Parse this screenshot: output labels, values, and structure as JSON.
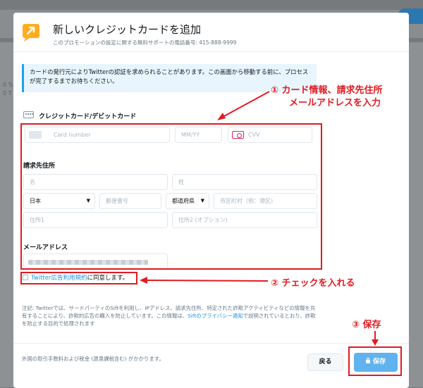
{
  "background": {
    "left_text": "0 Tu",
    "left_text2": "0 T"
  },
  "modal": {
    "title": "新しいクレジットカードを追加",
    "subtitle": "このプロモーションの設定に関する無料サポートの電話番号: 415-888-9999",
    "notice": "カードの発行元によりTwitterの認証を求められることがあります。この画面から移動する前に、プロセスが完了するまでお待ちください。",
    "card_section_label": "クレジットカード/デビットカード",
    "card_number_placeholder": "Card number",
    "expiry_placeholder": "MM/YY",
    "cvv_placeholder": "CVV",
    "billing_label": "請求先住所",
    "first_name_placeholder": "名",
    "last_name_placeholder": "姓",
    "country_value": "日本",
    "postal_placeholder": "郵便番号",
    "prefecture_value": "都道府県",
    "city_placeholder": "市区町村（例：港区)",
    "address1_placeholder": "住所1",
    "address2_placeholder": "住所2 (オプション)",
    "email_label": "メールアドレス",
    "agree_link": "Twitter広告利用規約",
    "agree_text": "に同意します。",
    "note_part1": "注記: Twitterでは、サードパーティのSiftを利用し、IPアドレス、請求先住所、特定された詐欺アクティビティなどの情報を共有することにより、詐欺的広告の購入を防止しています。この情報は、",
    "note_link": "Siftのプライバシー通知",
    "note_part2": "で説明されているとおり、詐欺を防止する目的で処理されます",
    "footer_text": "外国の取引手数料および税金 (源泉課税含む) がかかります。",
    "back_button": "戻る",
    "save_button": "保存"
  },
  "annotations": {
    "step1_line1": "① カード情報、請求先住所",
    "step1_line2": "メールアドレスを入力",
    "step2": "② チェックを入れる",
    "step3": "③ 保存"
  },
  "colors": {
    "accent": "#1da1f2",
    "annotation": "#e01b22",
    "save_button": "#61b3ef"
  }
}
